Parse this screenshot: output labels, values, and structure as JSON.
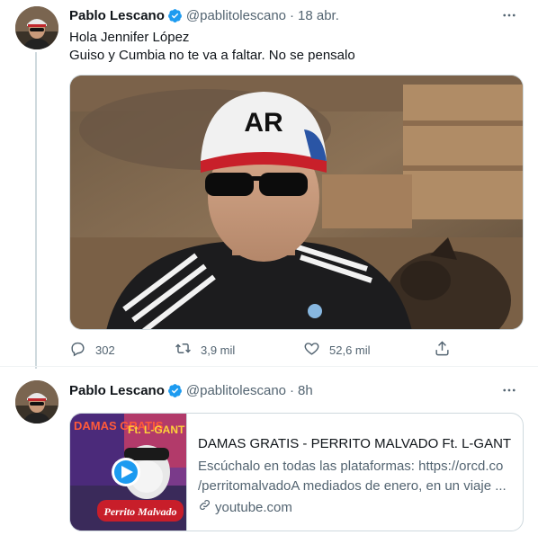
{
  "tweets": [
    {
      "author": {
        "name": "Pablo Lescano",
        "handle": "@pablitolescano",
        "verified": true
      },
      "time": "18 abr.",
      "text_lines": [
        "Hola Jennifer López",
        "Guiso y Cumbia no te va a faltar. No se pensalo"
      ],
      "media": {
        "cap_text": "AR"
      },
      "actions": {
        "replies": "302",
        "retweets": "3,9 mil",
        "likes": "52,6 mil"
      }
    },
    {
      "author": {
        "name": "Pablo Lescano",
        "handle": "@pablitolescano",
        "verified": true
      },
      "time": "8h",
      "card": {
        "title": "DAMAS GRATIS - PERRITO MALVADO Ft. L-GANTE ...",
        "description_lines": [
          "Escúchalo en todas las plataformas: https://orcd.co",
          "/perritomalvadoA mediados de enero, en un viaje ..."
        ],
        "domain": "youtube.com",
        "thumb_text_left": "DAMAS GRATIS",
        "thumb_text_right": "Ft. L-GANT",
        "thumb_banner": "Perrito Malvado"
      }
    }
  ],
  "colors": {
    "accent": "#1d9bf0",
    "secondary_text": "#536471",
    "primary_text": "#0f1419",
    "border": "#cfd9de"
  },
  "icons": {
    "verified": "verified-badge-icon",
    "more": "more-dots-icon",
    "reply": "reply-icon",
    "retweet": "retweet-icon",
    "like": "heart-icon",
    "share": "share-icon",
    "link": "link-icon",
    "play": "play-icon"
  }
}
